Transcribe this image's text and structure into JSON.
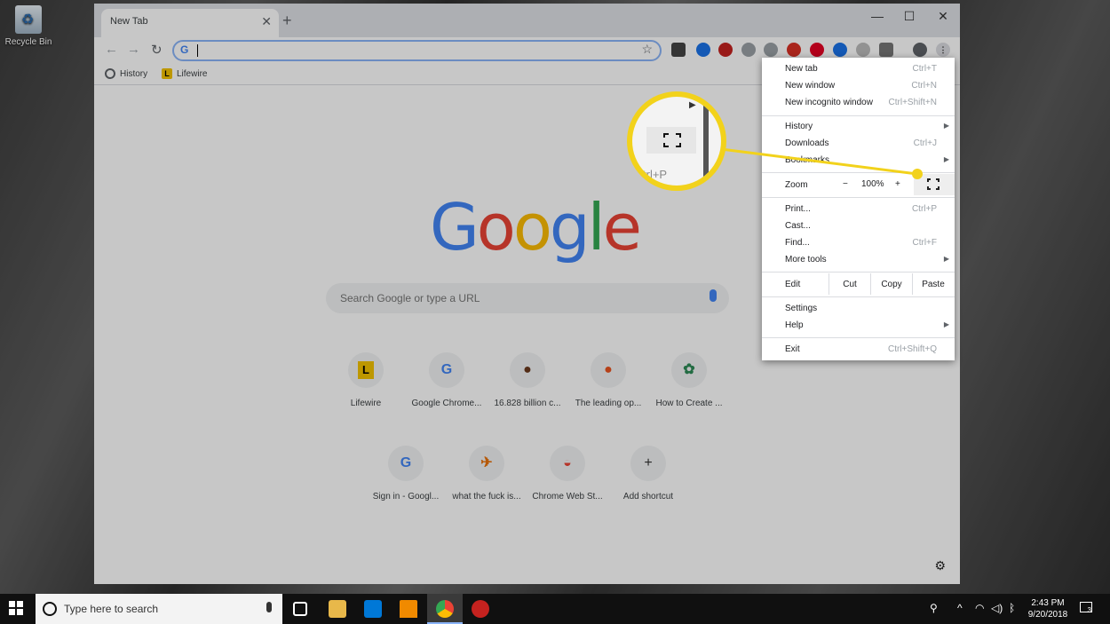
{
  "desktop": {
    "recycle_bin": "Recycle Bin"
  },
  "tab": {
    "title": "New Tab",
    "close": "✕",
    "new": "+"
  },
  "window_controls": {
    "minimize": "—",
    "maximize": "☐",
    "close": "✕"
  },
  "nav": {
    "back": "←",
    "forward": "→",
    "reload": "↻"
  },
  "omnibox": {
    "value": "",
    "favicon": "G"
  },
  "bookmarks": [
    {
      "label": "History"
    },
    {
      "label": "Lifewire"
    }
  ],
  "google_logo": [
    "G",
    "o",
    "o",
    "g",
    "l",
    "e"
  ],
  "logo_colors": [
    "#4285f4",
    "#ea4335",
    "#fbbc05",
    "#4285f4",
    "#34a853",
    "#ea4335"
  ],
  "search": {
    "placeholder": "Search Google or type a URL"
  },
  "shortcuts": [
    {
      "label": "Lifewire",
      "glyph": "L"
    },
    {
      "label": "Google Chrome...",
      "glyph": "G"
    },
    {
      "label": "16.828 billion c...",
      "glyph": "●"
    },
    {
      "label": "The leading op...",
      "glyph": "●"
    },
    {
      "label": "How to Create ...",
      "glyph": "✿"
    },
    {
      "label": "Sign in - Googl...",
      "glyph": "G"
    },
    {
      "label": "what the fuck is...",
      "glyph": "✈"
    },
    {
      "label": "Chrome Web St...",
      "glyph": "◒"
    },
    {
      "label": "Add shortcut",
      "glyph": "+"
    }
  ],
  "menu": {
    "new_tab": {
      "label": "New tab",
      "shortcut": "Ctrl+T"
    },
    "new_window": {
      "label": "New window",
      "shortcut": "Ctrl+N"
    },
    "incognito": {
      "label": "New incognito window",
      "shortcut": "Ctrl+Shift+N"
    },
    "history": {
      "label": "History"
    },
    "downloads": {
      "label": "Downloads",
      "shortcut": "Ctrl+J"
    },
    "bookmarks": {
      "label": "Bookmarks"
    },
    "zoom": {
      "label": "Zoom",
      "minus": "−",
      "value": "100%",
      "plus": "+"
    },
    "print": {
      "label": "Print...",
      "shortcut": "Ctrl+P"
    },
    "cast": {
      "label": "Cast..."
    },
    "find": {
      "label": "Find...",
      "shortcut": "Ctrl+F"
    },
    "more_tools": {
      "label": "More tools"
    },
    "edit": {
      "label": "Edit",
      "cut": "Cut",
      "copy": "Copy",
      "paste": "Paste"
    },
    "settings": {
      "label": "Settings"
    },
    "help": {
      "label": "Help"
    },
    "exit": {
      "label": "Exit",
      "shortcut": "Ctrl+Shift+Q"
    }
  },
  "callout": {
    "shortcut_text": "trl+P",
    "color": "#f2d21b"
  },
  "taskbar": {
    "search_placeholder": "Type here to search",
    "time": "2:43 PM",
    "date": "9/20/2018",
    "notifications": "3"
  }
}
